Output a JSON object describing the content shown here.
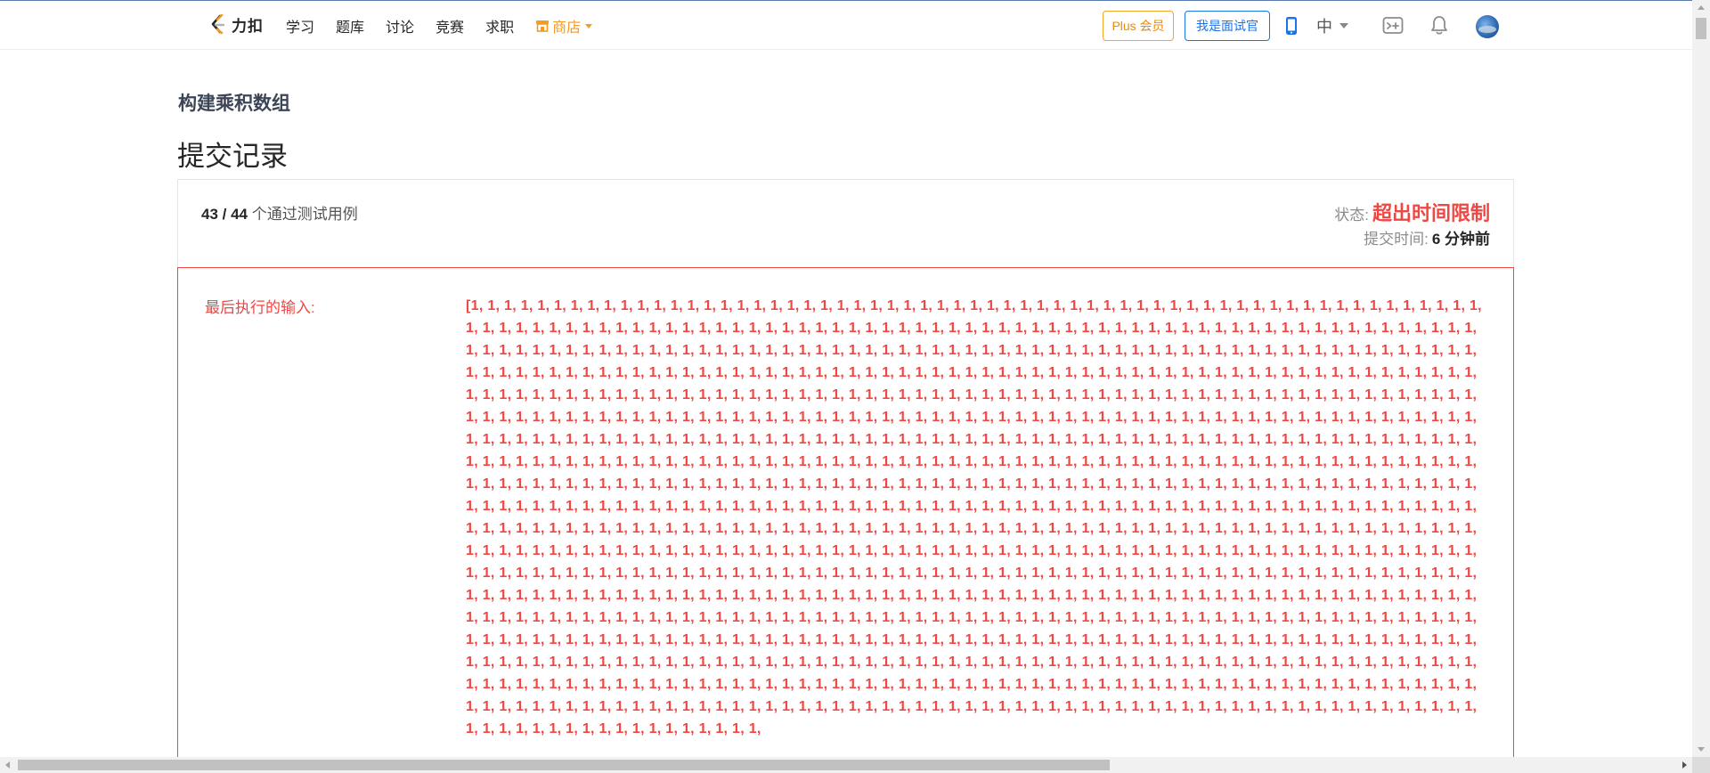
{
  "header": {
    "logo_text": "力扣",
    "nav": [
      {
        "label": "学习"
      },
      {
        "label": "题库"
      },
      {
        "label": "讨论"
      },
      {
        "label": "竞赛"
      },
      {
        "label": "求职"
      }
    ],
    "store_label": "商店",
    "plus_label": "Plus 会员",
    "interviewer_label": "我是面试官",
    "language": "中",
    "icons": [
      "logo-icon",
      "store-icon",
      "phone-icon",
      "console-icon",
      "bell-icon",
      "avatar"
    ]
  },
  "problem": {
    "title": "构建乘积数组"
  },
  "page": {
    "heading": "提交记录"
  },
  "summary": {
    "passed": "43 / 44",
    "passed_suffix": "个通过测试用例",
    "status_label": "状态:",
    "status_value": "超出时间限制",
    "time_label": "提交时间:",
    "time_value": "6 分钟前"
  },
  "last_input": {
    "label": "最后执行的输入:",
    "value_prefix": "[",
    "repeated_value": "1",
    "repeat_count": 1177
  },
  "colors": {
    "error": "#ef4743",
    "plus_border": "#f5a623",
    "interviewer_blue": "#1a73e8",
    "store_orange": "#f59a23"
  }
}
